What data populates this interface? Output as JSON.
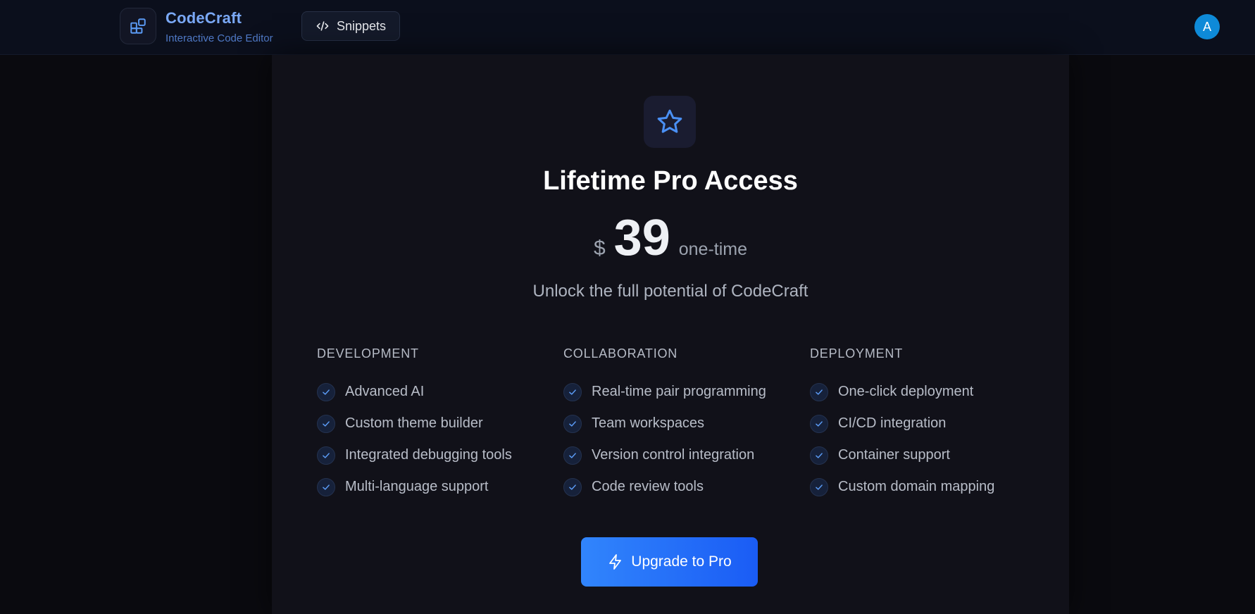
{
  "header": {
    "brand_name": "CodeCraft",
    "brand_subtitle": "Interactive Code Editor",
    "snippets_label": "Snippets",
    "avatar_initial": "A"
  },
  "pricing": {
    "title": "Lifetime Pro Access",
    "currency": "$",
    "amount": "39",
    "period": "one-time",
    "tagline": "Unlock the full potential of CodeCraft",
    "upgrade_label": "Upgrade to Pro"
  },
  "features": [
    {
      "title": "DEVELOPMENT",
      "items": [
        "Advanced AI",
        "Custom theme builder",
        "Integrated debugging tools",
        "Multi-language support"
      ]
    },
    {
      "title": "COLLABORATION",
      "items": [
        "Real-time pair programming",
        "Team workspaces",
        "Version control integration",
        "Code review tools"
      ]
    },
    {
      "title": "DEPLOYMENT",
      "items": [
        "One-click deployment",
        "CI/CD integration",
        "Container support",
        "Custom domain mapping"
      ]
    }
  ],
  "colors": {
    "accent": "#3b82f6",
    "avatar": "#0e8ad8",
    "background": "#0a0a0f"
  },
  "icons": {
    "logo": "blocks-icon",
    "snippets": "code-icon",
    "hero": "star-icon",
    "check": "check-icon",
    "upgrade": "zap-icon"
  }
}
